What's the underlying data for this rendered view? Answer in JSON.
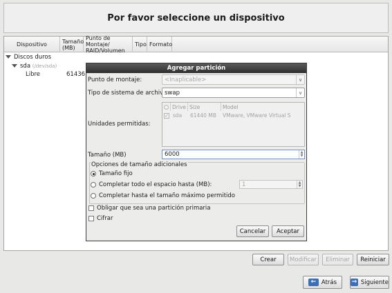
{
  "header": {
    "title": "Por favor seleccione un dispositivo"
  },
  "table": {
    "columns": [
      "Dispositivo",
      "Tamaño\n(MB)",
      "Punto de Montaje/\nRAID/Volumen",
      "Tipo",
      "Formato"
    ],
    "col1": "Dispositivo",
    "col2a": "Tamaño",
    "col2b": "(MB)",
    "col3a": "Punto de Montaje/",
    "col3b": "RAID/Volumen",
    "col4": "Tipo",
    "col5": "Formato",
    "group": "Discos duros",
    "disk": "sda",
    "disk_path": "(/dev/sda)",
    "free_label": "Libre",
    "free_size": "61436"
  },
  "dialog": {
    "title": "Agregar partición",
    "mount_label": "Punto de montaje:",
    "mount_value": "<Inaplicable>",
    "fstype_label": "Tipo de sistema de archivos:",
    "fstype_value": "swap",
    "drives_label": "Unidades permitidas:",
    "drives_cols": {
      "check": "",
      "drive": "Drive",
      "size": "Size",
      "model": "Model"
    },
    "drive_row": {
      "drive": "sda",
      "size": "61440 MB",
      "model": "VMware, VMware Virtual S"
    },
    "size_label": "Tamaño (MB)",
    "size_value": "6000",
    "options_title": "Opciones de tamaño adicionales",
    "opt_fixed": "Tamaño fijo",
    "opt_fill_until": "Completar todo el espacio hasta (MB):",
    "opt_fill_until_value": "1",
    "opt_fill_max": "Completar hasta el tamaño máximo permitido",
    "primary_label": "Obligar que sea una partición primaria",
    "encrypt_label": "Cifrar",
    "cancel": "Cancelar",
    "accept": "Aceptar"
  },
  "actions": {
    "create": "Crear",
    "modify": "Modificar",
    "delete": "Eliminar",
    "reset": "Reiniciar"
  },
  "nav": {
    "back": "Atrás",
    "next": "Siguiente"
  },
  "icons": {
    "back": "arrow-left-icon",
    "next": "arrow-right-icon"
  },
  "colors": {
    "title_bar": "#3a3a3a",
    "accent": "#3d6fb6"
  }
}
